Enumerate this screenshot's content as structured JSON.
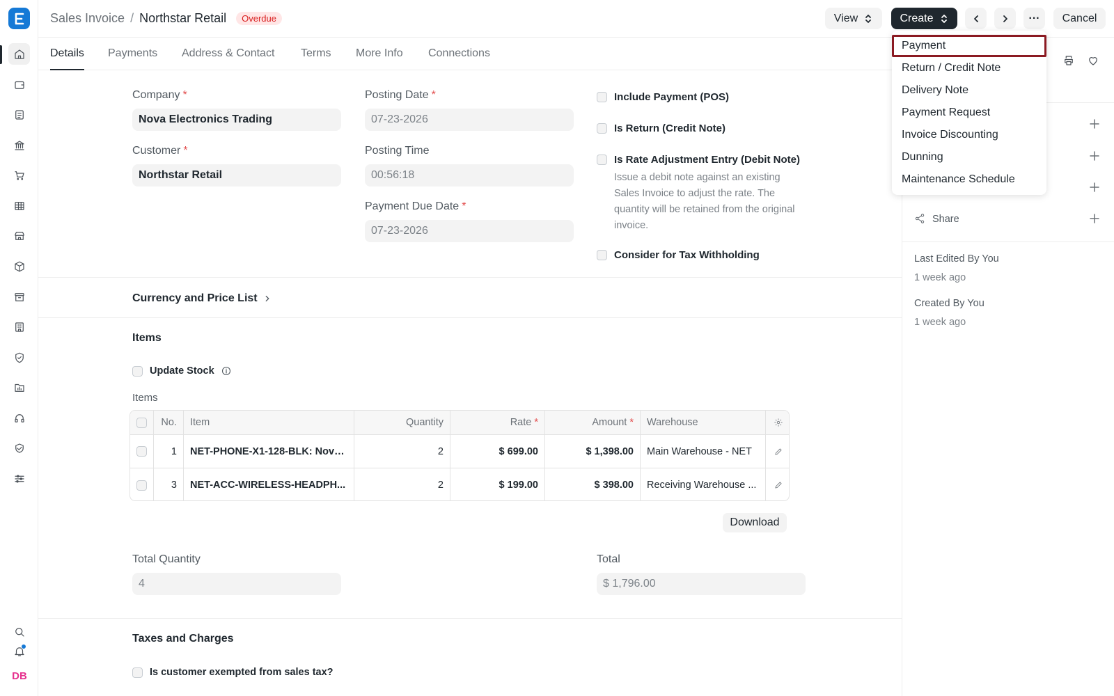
{
  "header": {
    "breadcrumb_parent": "Sales Invoice",
    "breadcrumb_sep": "/",
    "title": "Northstar Retail",
    "status": "Overdue",
    "view_label": "View",
    "create_label": "Create",
    "more_label": "···",
    "cancel_label": "Cancel"
  },
  "create_menu": {
    "items": [
      "Payment",
      "Return / Credit Note",
      "Delivery Note",
      "Payment Request",
      "Invoice Discounting",
      "Dunning",
      "Maintenance Schedule"
    ],
    "selected": "Payment"
  },
  "tabs": [
    "Details",
    "Payments",
    "Address & Contact",
    "Terms",
    "More Info",
    "Connections"
  ],
  "active_tab": "Details",
  "form": {
    "company_label": "Company",
    "company_value": "Nova Electronics Trading",
    "customer_label": "Customer",
    "customer_value": "Northstar Retail",
    "posting_date_label": "Posting Date",
    "posting_date_value": "07-23-2026",
    "posting_time_label": "Posting Time",
    "posting_time_value": "00:56:18",
    "due_date_label": "Payment Due Date",
    "due_date_value": "07-23-2026",
    "include_payment_label": "Include Payment (POS)",
    "is_return_label": "Is Return (Credit Note)",
    "rate_adjust_label": "Is Rate Adjustment Entry (Debit Note)",
    "rate_adjust_desc": "Issue a debit note against an existing Sales Invoice to adjust the rate. The quantity will be retained from the original invoice.",
    "tax_withholding_label": "Consider for Tax Withholding",
    "currency_section": "Currency and Price List",
    "items_section": "Items",
    "update_stock_label": "Update Stock",
    "items_table_label": "Items",
    "total_qty_label": "Total Quantity",
    "total_qty_value": "4",
    "total_label": "Total",
    "total_value": "$ 1,796.00",
    "taxes_section": "Taxes and Charges",
    "exempt_label": "Is customer exempted from sales tax?",
    "download_label": "Download"
  },
  "items_table": {
    "headers": {
      "no": "No.",
      "item": "Item",
      "qty": "Quantity",
      "rate": "Rate",
      "amount": "Amount",
      "warehouse": "Warehouse"
    },
    "rows": [
      {
        "no": "1",
        "item": "NET-PHONE-X1-128-BLK: Nova...",
        "qty": "2",
        "rate": "$ 699.00",
        "amount": "$ 1,398.00",
        "warehouse": "Main Warehouse - NET"
      },
      {
        "no": "3",
        "item": "NET-ACC-WIRELESS-HEADPH...",
        "qty": "2",
        "rate": "$ 199.00",
        "amount": "$ 398.00",
        "warehouse": "Receiving Warehouse ..."
      }
    ]
  },
  "sidebar": {
    "share_label": "Share",
    "last_edited": "Last Edited By You",
    "last_edited_time": "1 week ago",
    "created": "Created By You",
    "created_time": "1 week ago"
  },
  "user": {
    "initials": "DB"
  },
  "colors": {
    "accent": "#1579d6",
    "status_red": "#d92020",
    "highlight": "#8b1a22",
    "avatar": "#e6318e"
  }
}
